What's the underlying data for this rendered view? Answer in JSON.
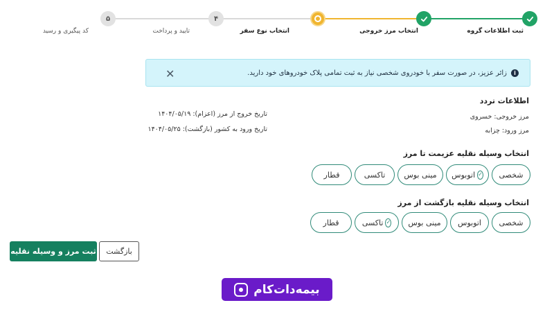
{
  "stepper": {
    "steps": [
      {
        "label": "ثبت اطلاعات گروه",
        "state": "done"
      },
      {
        "label": "انتخاب مرز خروجی",
        "state": "done"
      },
      {
        "label": "انتخاب نوع سفر",
        "state": "active"
      },
      {
        "label": "تایید و پرداخت",
        "number": "۴",
        "state": "todo"
      },
      {
        "label": "کد پیگیری و رسید",
        "number": "۵",
        "state": "todo"
      }
    ]
  },
  "alert": {
    "text": "زائر عزیز، در صورت سفر با خودروی شخصی نیاز به ثبت تمامی پلاک خودروهای خود دارید."
  },
  "travel_info": {
    "title": "اطلاعات تردد",
    "exit_border": "مرز خروجی: خسروی",
    "exit_date": "تاریخ خروج از مرز (اعزام): ۱۴۰۴/۰۵/۱۹",
    "entry_border": "مرز ورود: چزابه",
    "entry_date": "تاریخ ورود به کشور (بازگشت): ۱۴۰۴/۰۵/۲۵"
  },
  "outbound": {
    "title": "انتخاب وسیله نقلیه عزیمت تا مرز",
    "options": [
      {
        "label": "شخصی",
        "selected": false
      },
      {
        "label": "اتوبوس",
        "selected": true
      },
      {
        "label": "مینی بوس",
        "selected": false
      },
      {
        "label": "تاکسی",
        "selected": false
      },
      {
        "label": "قطار",
        "selected": false
      }
    ]
  },
  "return": {
    "title": "انتخاب وسیله نقلیه بازگشت از مرز",
    "options": [
      {
        "label": "شخصی",
        "selected": false
      },
      {
        "label": "اتوبوس",
        "selected": false
      },
      {
        "label": "مینی بوس",
        "selected": false
      },
      {
        "label": "تاکسی",
        "selected": true
      },
      {
        "label": "قطار",
        "selected": false
      }
    ]
  },
  "actions": {
    "submit_label": "ثبت مرز و وسیله نقلیه",
    "back_label": "بازگشت"
  },
  "logo": {
    "text": "بیمه‌دات‌کام"
  },
  "colors": {
    "success": "#21a366",
    "active": "#f0b52f",
    "primary_button": "#15805f",
    "alert_bg": "#d4f4fb",
    "chip_border": "#2f8a78",
    "brand": "#6a1bc9"
  }
}
